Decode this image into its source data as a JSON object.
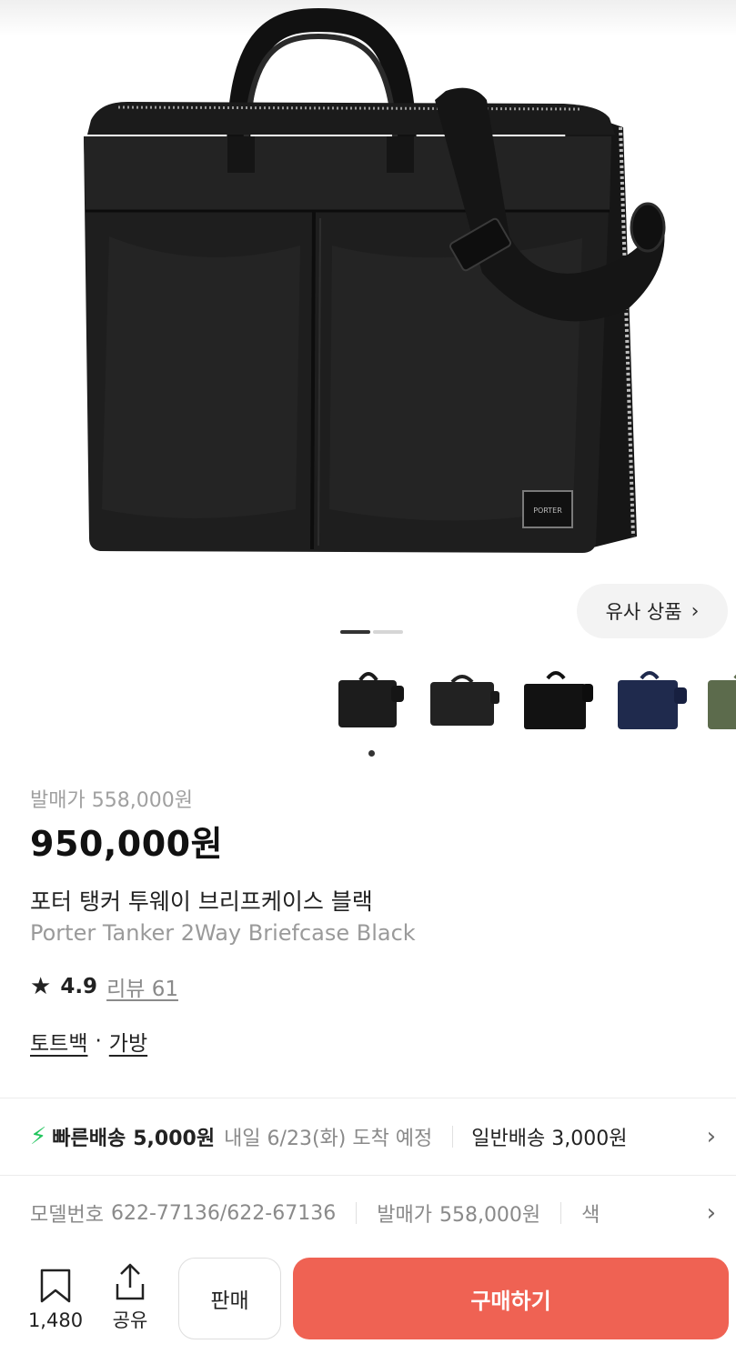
{
  "product": {
    "release_price_text": "발매가 558,000원",
    "price_text": "950,000원",
    "title_ko": "포터 탱커 투웨이 브리프케이스 블랙",
    "title_en": "Porter Tanker 2Way Briefcase Black",
    "rating": "4.9",
    "reviews_text": "리뷰 61",
    "brand_badge": "PORTER"
  },
  "gallery": {
    "similar_label": "유사 상품",
    "page_current": 1,
    "page_total": 2,
    "thumbnails": [
      {
        "color": "#1c1c1c",
        "icon": "bag-black-thumbnail"
      },
      {
        "color": "#222222",
        "icon": "bag-black-thumbnail"
      },
      {
        "color": "#121212",
        "icon": "bag-black-thumbnail"
      },
      {
        "color": "#1f2a4d",
        "icon": "bag-navy-thumbnail"
      },
      {
        "color": "#5c6b4c",
        "icon": "bag-olive-thumbnail"
      }
    ]
  },
  "categories": {
    "primary": "토트백",
    "separator": "·",
    "secondary": "가방"
  },
  "shipping": {
    "fast_label": "빠른배송",
    "fast_price": "5,000원",
    "eta": "내일 6/23(화) 도착 예정",
    "normal": "일반배송 3,000원"
  },
  "specs": [
    {
      "label": "모델번호",
      "value": "622-77136/622-67136"
    },
    {
      "label": "발매가",
      "value": "558,000원"
    },
    {
      "label": "색",
      "value": ""
    }
  ],
  "bottom_bar": {
    "bookmark_count": "1,480",
    "share_label": "공유",
    "sell_label": "판매",
    "buy_label": "구매하기"
  },
  "colors": {
    "accent_buy": "#ef6253",
    "fast_bolt": "#22c55e"
  }
}
